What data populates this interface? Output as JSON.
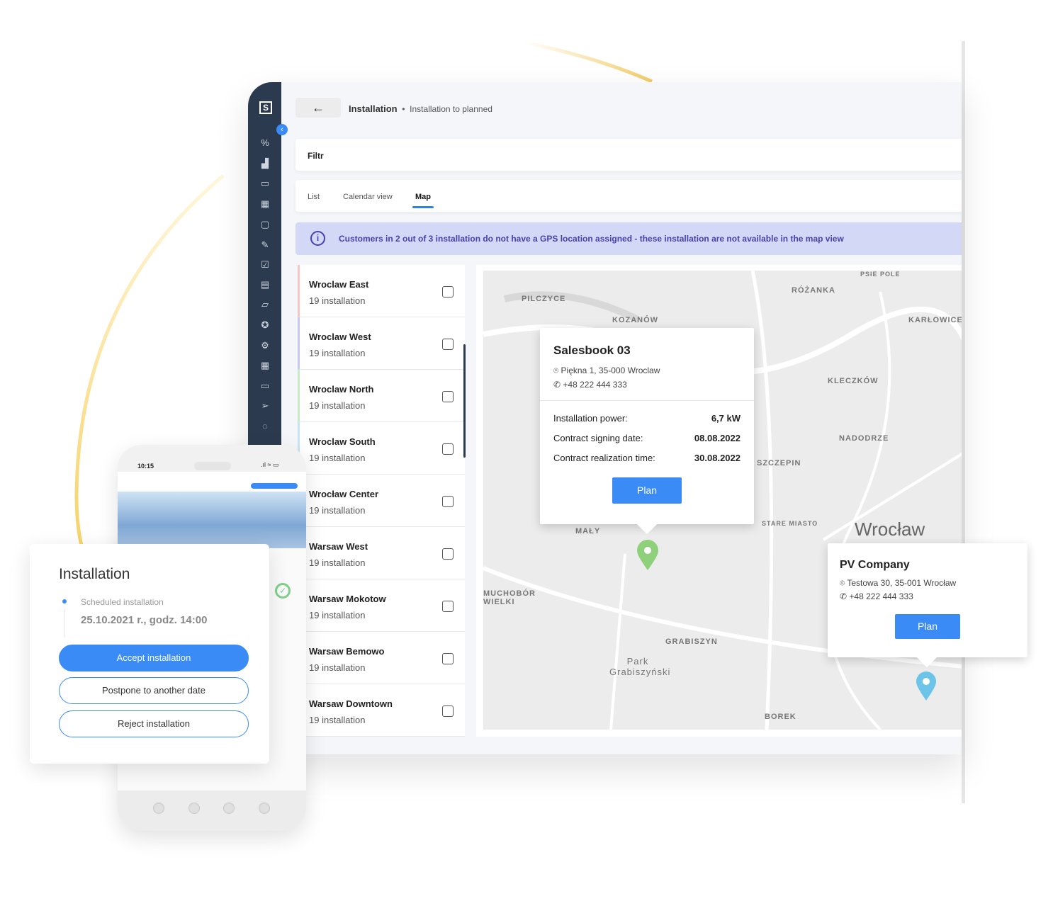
{
  "header": {
    "breadcrumb_main": "Installation",
    "breadcrumb_sub": "Installation to planned"
  },
  "filter": {
    "label": "Filtr"
  },
  "tabs": [
    {
      "label": "List"
    },
    {
      "label": "Calendar view"
    },
    {
      "label": "Map",
      "active": true
    }
  ],
  "info_banner": {
    "text": "Customers in 2 out of 3 installation do not have a GPS location assigned - these installation are not available in the map view"
  },
  "locations": [
    {
      "name": "Wroclaw East",
      "count": "19 installation",
      "accent": "#f5c6c6"
    },
    {
      "name": "Wroclaw West",
      "count": "19 installation",
      "accent": "#c8c8f5"
    },
    {
      "name": "Wroclaw North",
      "count": "19 installation",
      "accent": "#c6ecc6"
    },
    {
      "name": "Wroclaw South",
      "count": "19 installation",
      "accent": "#c6e4f5"
    },
    {
      "name": "Wrocław Center",
      "count": "19 installation",
      "accent": "#eee"
    },
    {
      "name": "Warsaw West",
      "count": "19 installation",
      "accent": "#eee"
    },
    {
      "name": "Warsaw Mokotow",
      "count": "19 installation",
      "accent": "#eee"
    },
    {
      "name": "Warsaw Bemowo",
      "count": "19 installation",
      "accent": "#eee"
    },
    {
      "name": "Warsaw Downtown",
      "count": "19 installation",
      "accent": "#eee"
    }
  ],
  "map": {
    "labels": [
      "PILCZYCE",
      "KOZANÓW",
      "RÓŻANKA",
      "PSIE POLE",
      "KARŁOWICE",
      "KLECZKÓW",
      "NADODRZE",
      "SZCZEPIN",
      "STARE MIASTO",
      "Wrocław",
      "MUCHOBÓR WIELKI",
      "GRABISZYN",
      "Park Grabiszyński",
      "BOREK",
      "MAŁY"
    ],
    "popup1": {
      "title": "Salesbook 03",
      "address": "Piękna 1, 35-000 Wroclaw",
      "phone": "+48 222 444 333",
      "power_label": "Installation power:",
      "power": "6,7 kW",
      "signing_label": "Contract signing date:",
      "signing": "08.08.2022",
      "realization_label": "Contract realization time:",
      "realization": "30.08.2022",
      "plan": "Plan"
    },
    "popup2": {
      "title": "PV Company",
      "address": "Testowa 30, 35-001 Wrocław",
      "phone": "+48 222 444 333",
      "plan": "Plan"
    },
    "pin_colors": {
      "green": "#8fd17a",
      "blue": "#6cc4e8"
    }
  },
  "mobile": {
    "time": "10:15"
  },
  "install_card": {
    "title": "Installation",
    "scheduled_label": "Scheduled installation",
    "scheduled_date": "25.10.2021 r., godz. 14:00",
    "accept": "Accept installation",
    "postpone": "Postpone to another date",
    "reject": "Reject installation"
  }
}
